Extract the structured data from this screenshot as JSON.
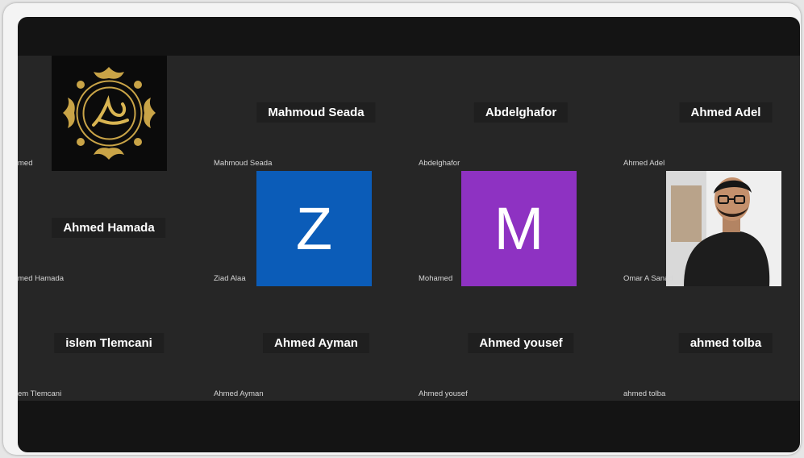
{
  "participants": [
    {
      "tile_name": "",
      "label": "med"
    },
    {
      "tile_name": "Mahmoud Seada",
      "label": "Mahmoud Seada"
    },
    {
      "tile_name": "Abdelghafor",
      "label": "Abdelghafor"
    },
    {
      "tile_name": "Ahmed Adel",
      "label": "Ahmed Adel"
    },
    {
      "tile_name": "Ahmed Hamada",
      "label": "med Hamada"
    },
    {
      "tile_name": "",
      "label": "Ziad Alaa",
      "avatar_letter": "Z",
      "avatar_color": "#0b5cb8"
    },
    {
      "tile_name": "",
      "label": "Mohamed",
      "avatar_letter": "M",
      "avatar_color": "#8e32c2"
    },
    {
      "tile_name": "",
      "label": "Omar A Sanad"
    },
    {
      "tile_name": "islem Tlemcani",
      "label": "em Tlemcani"
    },
    {
      "tile_name": "Ahmed Ayman",
      "label": "Ahmed Ayman"
    },
    {
      "tile_name": "Ahmed yousef",
      "label": "Ahmed yousef"
    },
    {
      "tile_name": "ahmed tolba",
      "label": "ahmed tolba"
    }
  ],
  "icons": {
    "emblem": "calligraphy-emblem-icon",
    "photo": "person-photo"
  },
  "colors": {
    "background": "#262626",
    "frame": "#141414",
    "text": "#ffffff"
  }
}
